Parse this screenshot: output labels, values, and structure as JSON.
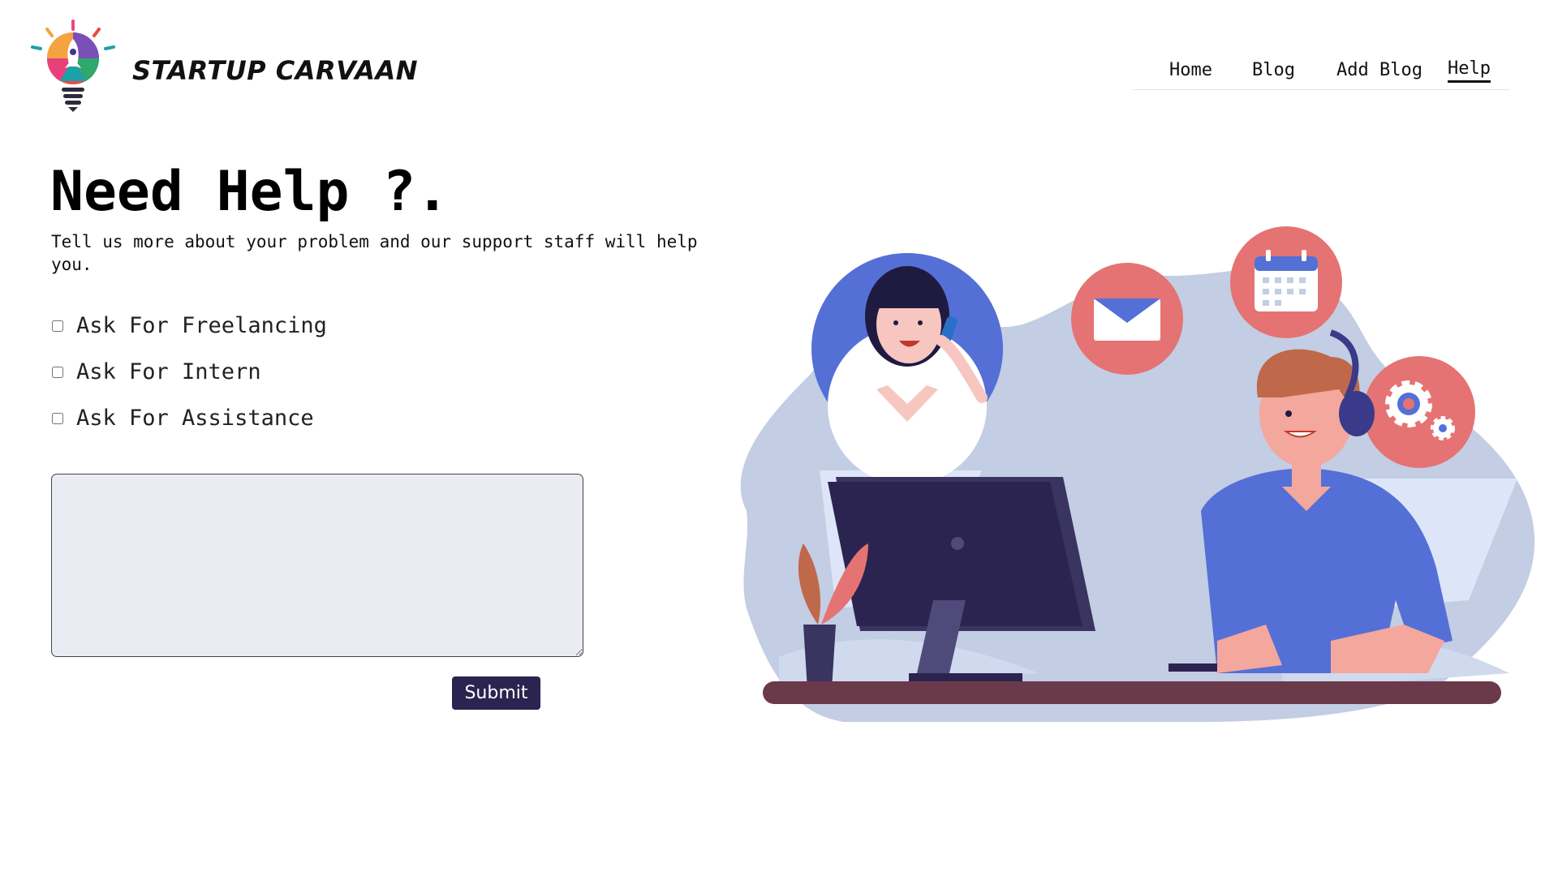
{
  "header": {
    "brand": "STARTUP CARVAAN",
    "logo_icon": "rocket-lightbulb-logo",
    "nav": [
      {
        "label": "Home",
        "active": false
      },
      {
        "label": "Blog",
        "active": false
      },
      {
        "label": "Add Blog",
        "active": false
      },
      {
        "label": "Help",
        "active": true
      }
    ]
  },
  "main": {
    "title": "Need Help ?.",
    "subtitle": "Tell us more about your problem and our support staff will help you.",
    "options": [
      {
        "label": "Ask For Freelancing",
        "checked": false
      },
      {
        "label": "Ask For Intern",
        "checked": false
      },
      {
        "label": "Ask For Assistance",
        "checked": false
      }
    ],
    "message": {
      "value": "",
      "placeholder": ""
    },
    "submit_label": "Submit"
  },
  "illustration": {
    "icons": [
      "support-agent-icon",
      "mail-icon",
      "calendar-icon",
      "settings-gear-icon"
    ]
  },
  "colors": {
    "accent": "#2b2450",
    "bubble_red": "#e57373",
    "blob": "#c3cde3",
    "shirt_blue": "#5470d6",
    "textarea_bg": "#e9edf3"
  }
}
